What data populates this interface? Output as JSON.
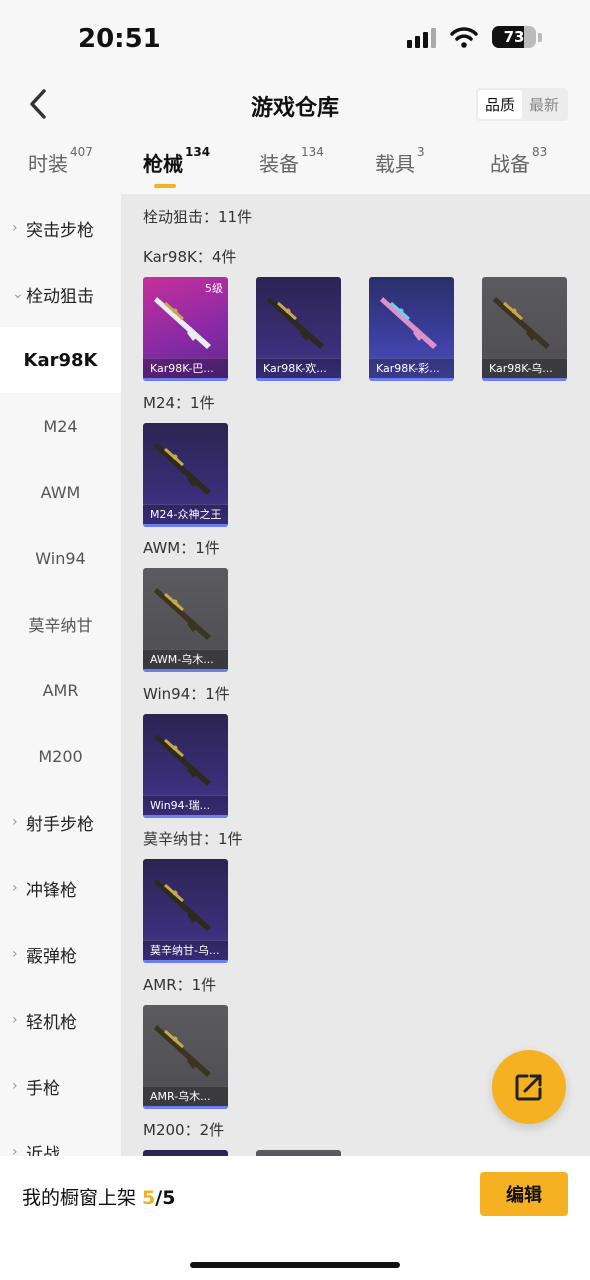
{
  "status": {
    "time": "20:51",
    "battery": "73",
    "battery_level": 0.73
  },
  "nav": {
    "title": "游戏仓库",
    "sort_quality": "品质",
    "sort_latest": "最新"
  },
  "tabs": [
    {
      "label": "时装",
      "count": "407"
    },
    {
      "label": "枪械",
      "count": "134"
    },
    {
      "label": "装备",
      "count": "134"
    },
    {
      "label": "载具",
      "count": "3"
    },
    {
      "label": "战备",
      "count": "83"
    }
  ],
  "sidebar": [
    {
      "label": "突击步枪",
      "kind": "cat",
      "chevron": "›"
    },
    {
      "label": "栓动狙击",
      "kind": "cat",
      "chevron": "⌄"
    },
    {
      "label": "Kar98K",
      "kind": "sub"
    },
    {
      "label": "M24",
      "kind": "sub"
    },
    {
      "label": "AWM",
      "kind": "sub"
    },
    {
      "label": "Win94",
      "kind": "sub"
    },
    {
      "label": "莫辛纳甘",
      "kind": "sub"
    },
    {
      "label": "AMR",
      "kind": "sub"
    },
    {
      "label": "M200",
      "kind": "sub"
    },
    {
      "label": "射手步枪",
      "kind": "cat",
      "chevron": "›"
    },
    {
      "label": "冲锋枪",
      "kind": "cat",
      "chevron": "›"
    },
    {
      "label": "霰弹枪",
      "kind": "cat",
      "chevron": "›"
    },
    {
      "label": "轻机枪",
      "kind": "cat",
      "chevron": "›"
    },
    {
      "label": "手枪",
      "kind": "cat",
      "chevron": "›"
    },
    {
      "label": "近战",
      "kind": "cat",
      "chevron": "›"
    }
  ],
  "content": {
    "category_header": "栓动狙击：11件",
    "sections": [
      {
        "label": "Kar98K：4件",
        "items": [
          {
            "name": "Kar98K-巴...",
            "level": "5级",
            "style": "magenta"
          },
          {
            "name": "Kar98K-欢...",
            "style": "purple"
          },
          {
            "name": "Kar98K-彩...",
            "style": "blue"
          },
          {
            "name": "Kar98K-乌...",
            "style": "gray"
          }
        ]
      },
      {
        "label": "M24：1件",
        "items": [
          {
            "name": "M24-众神之王",
            "style": "purple"
          }
        ]
      },
      {
        "label": "AWM：1件",
        "items": [
          {
            "name": "AWM-乌木...",
            "style": "gray"
          }
        ]
      },
      {
        "label": "Win94：1件",
        "items": [
          {
            "name": "Win94-瑞...",
            "style": "purple"
          }
        ]
      },
      {
        "label": "莫辛纳甘：1件",
        "items": [
          {
            "name": "莫辛纳甘-乌...",
            "style": "purple"
          }
        ]
      },
      {
        "label": "AMR：1件",
        "items": [
          {
            "name": "AMR-乌木...",
            "style": "gray"
          }
        ]
      },
      {
        "label": "M200：2件",
        "items": [
          {
            "name": "",
            "style": "purple"
          },
          {
            "name": "",
            "style": "gray"
          }
        ]
      }
    ]
  },
  "bottom": {
    "showcase_label": "我的橱窗上架 ",
    "showcase_count": "5",
    "showcase_total": "/5",
    "edit_label": "编辑"
  }
}
